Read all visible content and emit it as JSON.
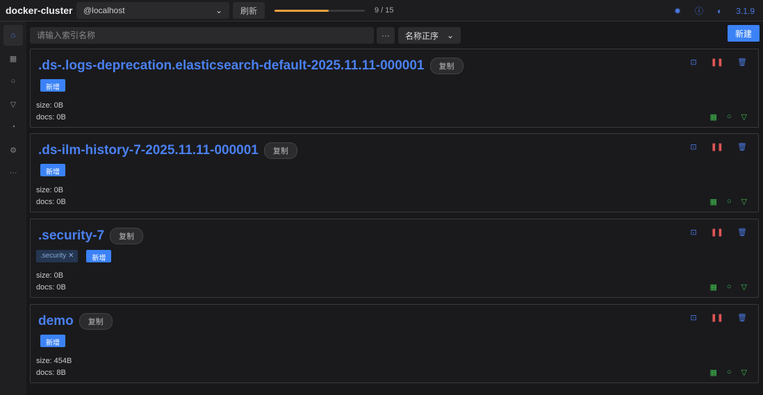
{
  "header": {
    "cluster": "docker-cluster",
    "host": "@localhost",
    "refresh": "刷新",
    "progress": {
      "current": 9,
      "total": 15,
      "label": "9 / 15"
    },
    "version": "3.1.9"
  },
  "toolbar": {
    "search_placeholder": "请输入索引名称",
    "more": "···",
    "sort": "名称正序",
    "new": "新建"
  },
  "sidebar": [
    "home",
    "grid",
    "search",
    "filter",
    "dashboard",
    "settings",
    "more"
  ],
  "labels": {
    "copy": "复制",
    "add": "新增"
  },
  "indices": [
    {
      "name": ".ds-.logs-deprecation.elasticsearch-default-2025.11.11-000001",
      "aliases": [],
      "size": "size: 0B",
      "docs": "docs: 0B"
    },
    {
      "name": ".ds-ilm-history-7-2025.11.11-000001",
      "aliases": [],
      "size": "size: 0B",
      "docs": "docs: 0B"
    },
    {
      "name": ".security-7",
      "aliases": [
        ".security"
      ],
      "size": "size: 0B",
      "docs": "docs: 0B"
    },
    {
      "name": "demo",
      "aliases": [],
      "size": "size: 454B",
      "docs": "docs: 8B"
    }
  ],
  "colors": {
    "accent": "#3b82f6",
    "progress": "#f0a040",
    "danger": "#e05555",
    "success": "#3fbf4f"
  }
}
